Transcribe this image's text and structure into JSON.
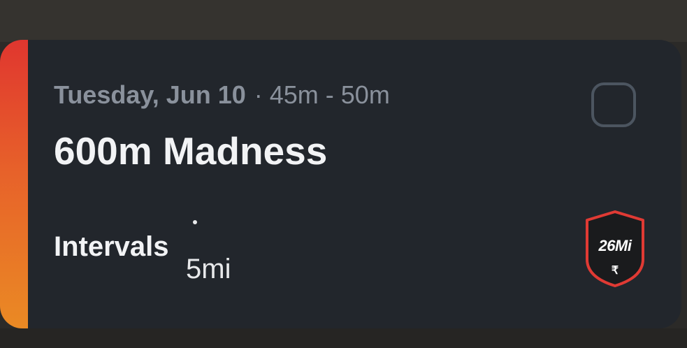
{
  "workout": {
    "date": "Tuesday, Jun 10",
    "separator": "·",
    "duration": "45m - 50m",
    "title": "600m Madness",
    "type": "Intervals",
    "type_separator": "·",
    "distance": "5mi",
    "completed": false
  },
  "badge": {
    "label": "26Mi",
    "icon_glyph": "₹",
    "icon": "runner-icon",
    "fill_color": "#1a1b1d",
    "border_color": "#e03a34"
  },
  "colors": {
    "accent_top": "#e0362f",
    "accent_bottom": "#ea8a24",
    "card_bg": "#22262c"
  }
}
